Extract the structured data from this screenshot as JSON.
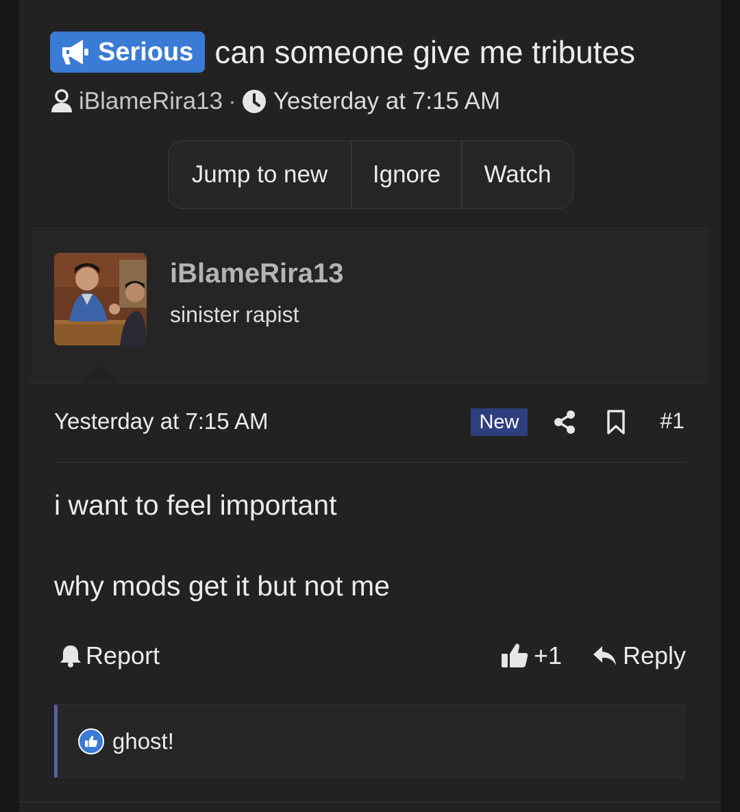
{
  "thread": {
    "prefix": "Serious",
    "title": "can someone give me tributes",
    "author": "iBlameRira13",
    "separator": "·",
    "time": "Yesterday at 7:15 AM"
  },
  "thread_buttons": [
    "Jump to new",
    "Ignore",
    "Watch"
  ],
  "post": {
    "username": "iBlameRira13",
    "user_title": "sinister rapist",
    "date": "Yesterday at 7:15 AM",
    "new_badge": "New",
    "post_number": "#1",
    "body": [
      "i want to feel important",
      "why mods get it but not me"
    ],
    "report_label": "Report",
    "like_count": "+1",
    "reply_label": "Reply",
    "reaction_user": "ghost!"
  },
  "colors": {
    "accent": "#3a7bd5",
    "new_badge": "#2d3f7e",
    "reaction_border": "#5b5ea6",
    "background": "#222223"
  },
  "icons": [
    "megaphone-icon",
    "user-icon",
    "clock-icon",
    "share-icon",
    "bookmark-icon",
    "bell-icon",
    "thumbs-up-icon",
    "reply-icon"
  ]
}
